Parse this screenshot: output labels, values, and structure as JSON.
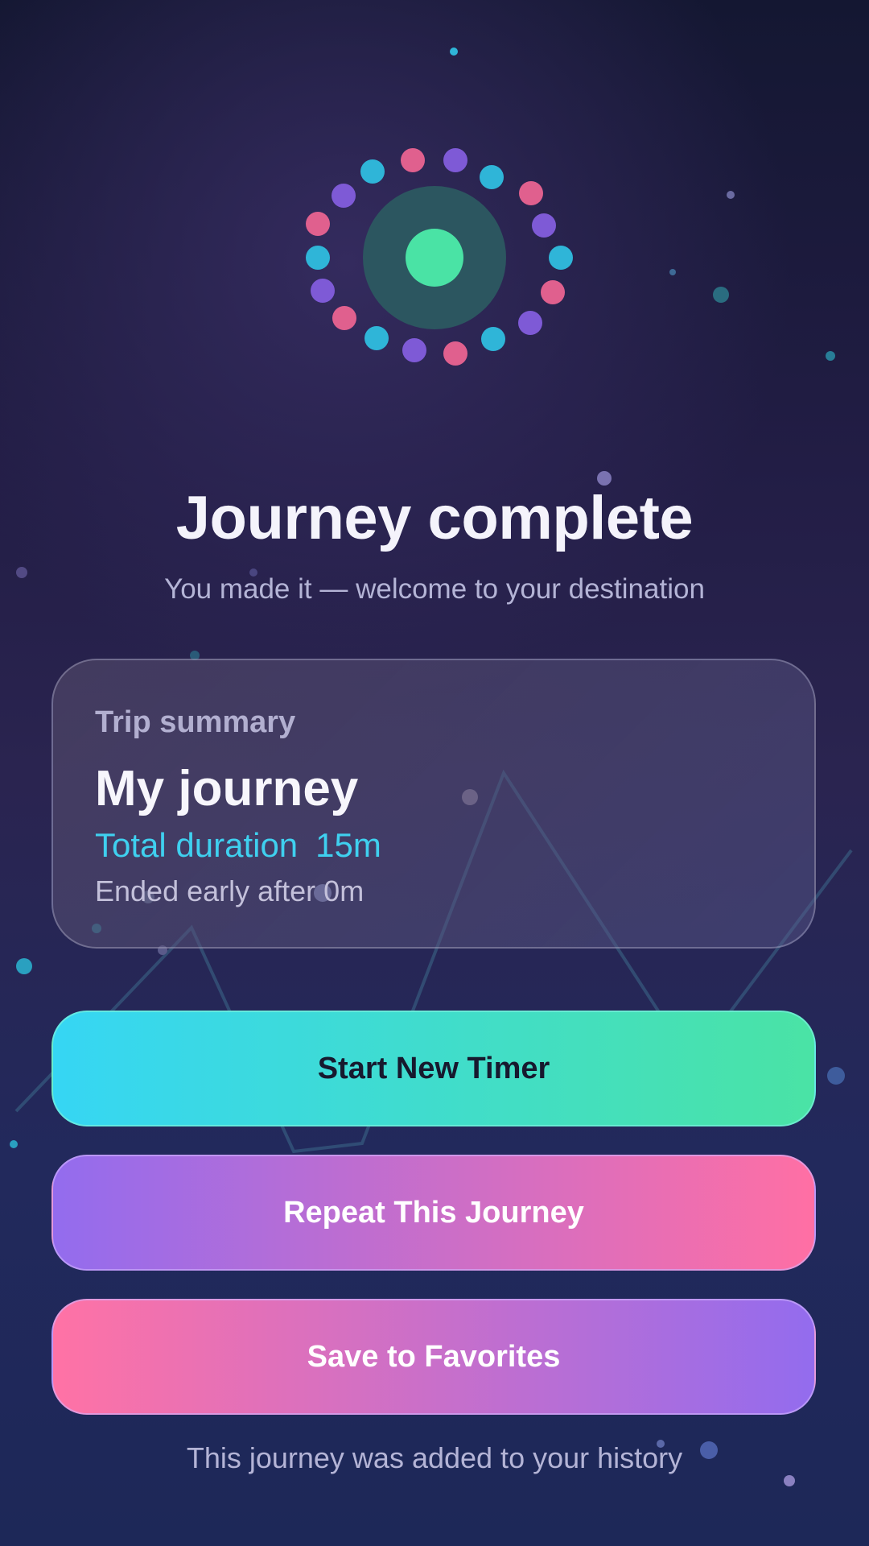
{
  "header": {
    "title": "Journey complete",
    "subtitle": "You made it — welcome to your destination"
  },
  "summary_card": {
    "label": "Trip summary",
    "journey_name": "My journey",
    "duration_label": "Total duration",
    "duration_value": "15m",
    "ended_note": "Ended early after 0m"
  },
  "buttons": {
    "start_new": "Start New Timer",
    "repeat": "Repeat This Journey",
    "save_favorites": "Save to Favorites"
  },
  "footer": {
    "note": "This journey was added to your history"
  },
  "icons": {
    "badge": "journey-complete-ring-icon"
  },
  "colors": {
    "accent_cyan": "#36d6f4",
    "accent_green": "#4ae3a5",
    "accent_purple": "#936cee",
    "accent_pink": "#ff6fa4",
    "ring_pink": "#e0608e",
    "ring_purple": "#7e5ad6",
    "ring_cyan": "#2fb5d8"
  }
}
